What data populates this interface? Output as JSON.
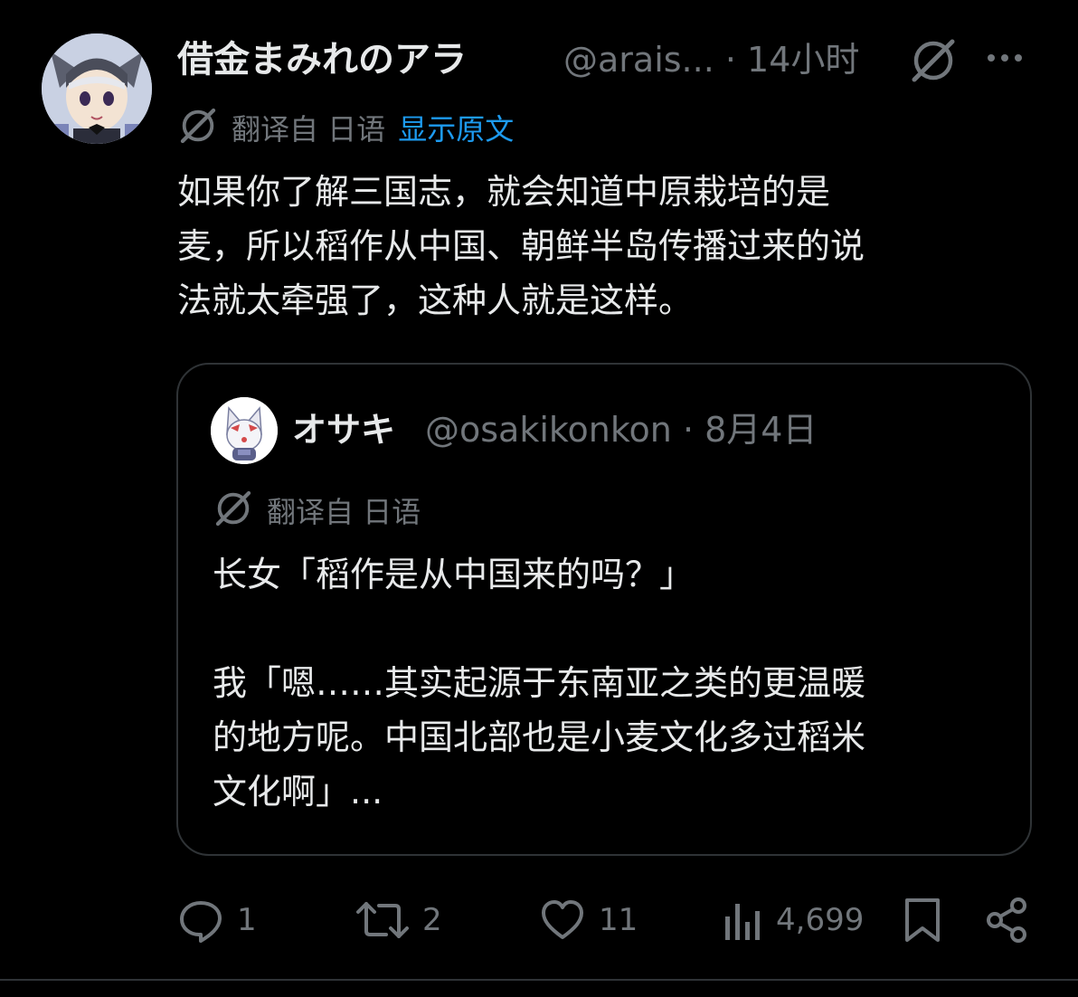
{
  "tweet": {
    "author_name": "借金まみれのアラ",
    "author_handle": "@arais...",
    "time": "14小时",
    "translated_from": "翻译自 日语",
    "show_original": "显示原文",
    "text_lines": [
      "如果你了解三国志，就会知道中原栽培的是",
      "麦，所以稻作从中国、朝鲜半岛传播过来的说",
      "法就太牵强了，这种人就是这样。"
    ]
  },
  "quote": {
    "author_name": "オサキ",
    "author_handle": "@osakikonkon",
    "time": "8月4日",
    "translated_from": "翻译自 日语",
    "text_lines": [
      "长女「稻作是从中国来的吗？」",
      "",
      "我「嗯……其实起源于东南亚之类的更温暖",
      "的地方呢。中国北部也是小麦文化多过稻米",
      "文化啊」..."
    ]
  },
  "actions": {
    "replies": "1",
    "retweets": "2",
    "likes": "11",
    "views": "4,699"
  },
  "colors": {
    "background": "#000000",
    "text": "#e7e9ea",
    "muted": "#71767b",
    "link": "#1d9bf0",
    "border": "#2f3336"
  }
}
